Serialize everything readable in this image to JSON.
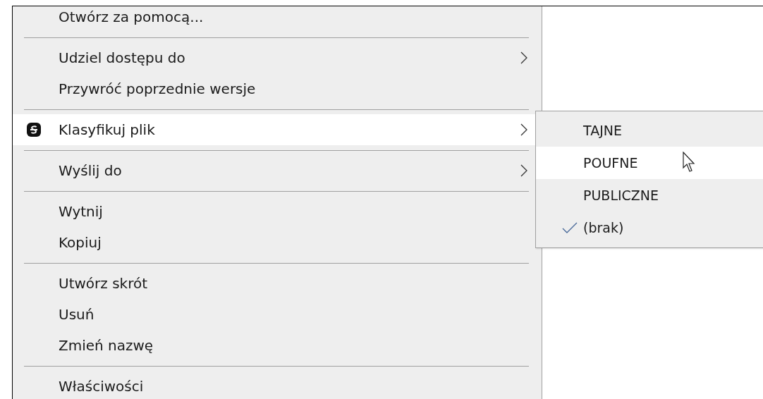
{
  "menu": {
    "items": [
      {
        "kind": "item",
        "label": "Otwórz za pomocą...",
        "has_submenu": false,
        "has_icon": false,
        "selected": false
      },
      {
        "kind": "separator"
      },
      {
        "kind": "item",
        "label": "Udziel dostępu do",
        "has_submenu": true,
        "has_icon": false,
        "selected": false
      },
      {
        "kind": "item",
        "label": "Przywróć poprzednie wersje",
        "has_submenu": false,
        "has_icon": false,
        "selected": false
      },
      {
        "kind": "separator"
      },
      {
        "kind": "item",
        "label": "Klasyfikuj plik",
        "has_submenu": true,
        "has_icon": true,
        "selected": true
      },
      {
        "kind": "separator"
      },
      {
        "kind": "item",
        "label": "Wyślij do",
        "has_submenu": true,
        "has_icon": false,
        "selected": false
      },
      {
        "kind": "separator"
      },
      {
        "kind": "item",
        "label": "Wytnij",
        "has_submenu": false,
        "has_icon": false,
        "selected": false
      },
      {
        "kind": "item",
        "label": "Kopiuj",
        "has_submenu": false,
        "has_icon": false,
        "selected": false
      },
      {
        "kind": "separator"
      },
      {
        "kind": "item",
        "label": "Utwórz skrót",
        "has_submenu": false,
        "has_icon": false,
        "selected": false
      },
      {
        "kind": "item",
        "label": "Usuń",
        "has_submenu": false,
        "has_icon": false,
        "selected": false
      },
      {
        "kind": "item",
        "label": "Zmień nazwę",
        "has_submenu": false,
        "has_icon": false,
        "selected": false
      },
      {
        "kind": "separator"
      },
      {
        "kind": "item",
        "label": "Właściwości",
        "has_submenu": false,
        "has_icon": false,
        "selected": false
      }
    ]
  },
  "submenu": {
    "items": [
      {
        "label": "TAJNE",
        "checked": false,
        "selected": false
      },
      {
        "label": "POUFNE",
        "checked": false,
        "selected": true
      },
      {
        "label": "PUBLICZNE",
        "checked": false,
        "selected": false
      },
      {
        "label": "(brak)",
        "checked": true,
        "selected": false
      }
    ]
  }
}
